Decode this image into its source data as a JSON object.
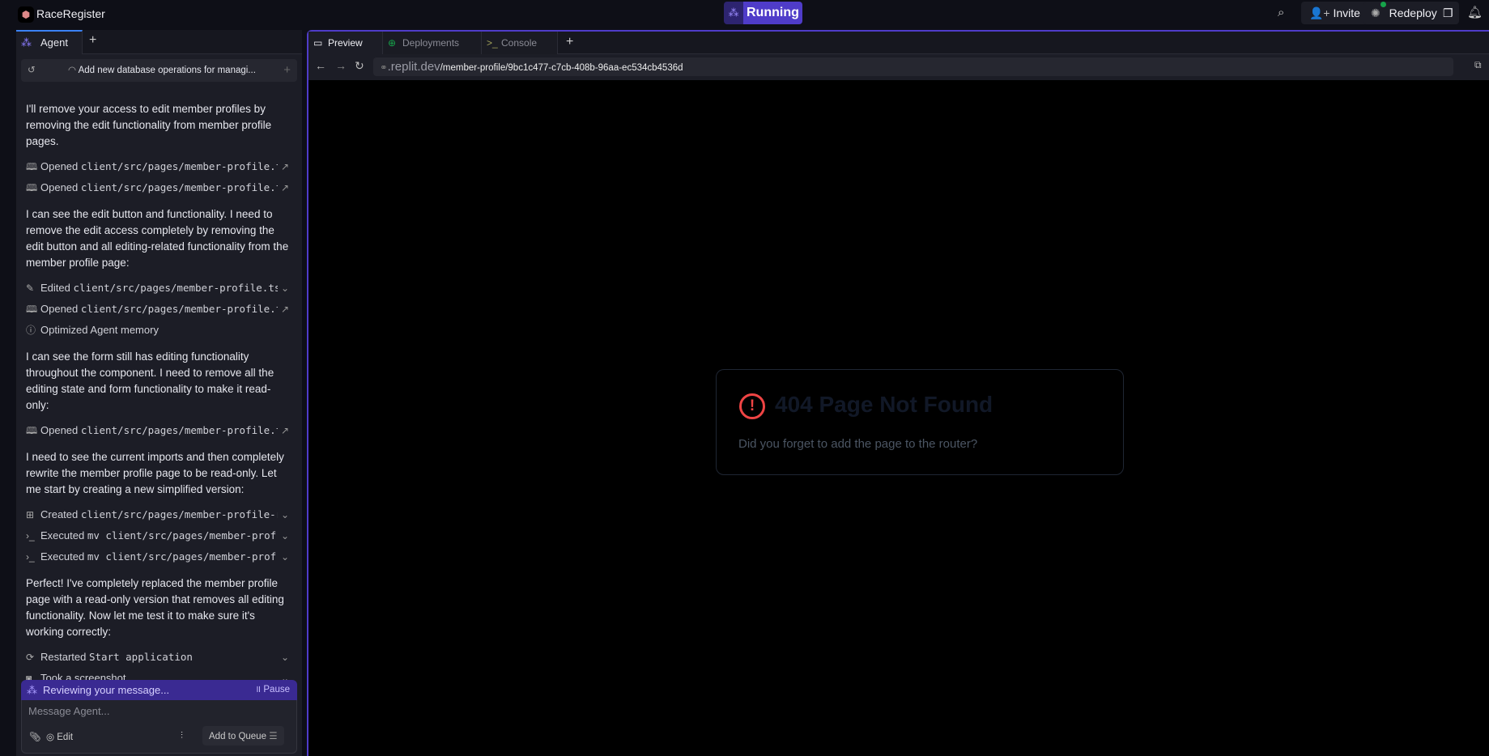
{
  "app": {
    "name": "RaceRegister",
    "status": "Running"
  },
  "topbar": {
    "invite": "Invite",
    "redeploy": "Redeploy"
  },
  "agent": {
    "tab": "Agent",
    "thread_title": "Add new database operations for managi...",
    "items": [
      {
        "type": "para",
        "text": "I'll remove your access to edit member profiles by removing the edit functionality from member profile pages."
      },
      {
        "type": "act",
        "icon": "book-icon",
        "verb": "Opened",
        "code": "client/src/pages/member-profile.t...",
        "right": "open-external-icon"
      },
      {
        "type": "act",
        "icon": "book-icon",
        "verb": "Opened",
        "code": "client/src/pages/member-profile.t...",
        "right": "open-external-icon"
      },
      {
        "type": "para",
        "text": "I can see the edit button and functionality. I need to remove the edit access completely by removing the edit button and all editing-related functionality from the member profile page:"
      },
      {
        "type": "act",
        "icon": "edit-icon",
        "verb": "Edited",
        "code": "client/src/pages/member-profile.tsx",
        "right": "chevron-down-icon"
      },
      {
        "type": "act",
        "icon": "book-icon",
        "verb": "Opened",
        "code": "client/src/pages/member-profile.t...",
        "right": "open-external-icon"
      },
      {
        "type": "act",
        "icon": "memory-icon",
        "verb": "Optimized Agent memory",
        "code": "",
        "right": ""
      },
      {
        "type": "para",
        "text": "I can see the form still has editing functionality throughout the component. I need to remove all the editing state and form functionality to make it read-only:"
      },
      {
        "type": "act",
        "icon": "book-icon",
        "verb": "Opened",
        "code": "client/src/pages/member-profile.t...",
        "right": "open-external-icon"
      },
      {
        "type": "para",
        "text": "I need to see the current imports and then completely rewrite the member profile page to be read-only. Let me start by creating a new simplified version:"
      },
      {
        "type": "act",
        "icon": "file-plus-icon",
        "verb": "Created",
        "code": "client/src/pages/member-profile-r...",
        "right": "chevron-down-icon"
      },
      {
        "type": "act",
        "icon": "terminal-icon",
        "verb": "Executed",
        "code": "mv client/src/pages/member-prof...",
        "right": "chevron-down-icon"
      },
      {
        "type": "act",
        "icon": "terminal-icon",
        "verb": "Executed",
        "code": "mv client/src/pages/member-prof...",
        "right": "chevron-down-icon"
      },
      {
        "type": "para",
        "text": "Perfect! I've completely replaced the member profile page with a read-only version that removes all editing functionality. Now let me test it to make sure it's working correctly:"
      },
      {
        "type": "act",
        "icon": "refresh-icon",
        "verb": "Restarted",
        "code": "Start application",
        "right": "chevron-down-icon"
      },
      {
        "type": "act",
        "icon": "camera-icon",
        "verb": "Took a screenshot",
        "code": "",
        "right": "chevron-down-icon"
      }
    ],
    "status": "Reviewing your message...",
    "pause": "Pause",
    "input_placeholder": "Message Agent...",
    "edit": "Edit",
    "queue": "Add to Queue"
  },
  "preview": {
    "tabs": [
      "Preview",
      "Deployments",
      "Console"
    ],
    "url_domain": ".replit.dev",
    "url_path": "/member-profile/9bc1c477-c7cb-408b-96aa-ec534cb4536d",
    "error_title": "404 Page Not Found",
    "error_message": "Did you forget to add the page to the router?"
  },
  "colors": {
    "accent": "#4f3cc9",
    "error": "#ef4444",
    "status_bar": "#3a2a92"
  }
}
